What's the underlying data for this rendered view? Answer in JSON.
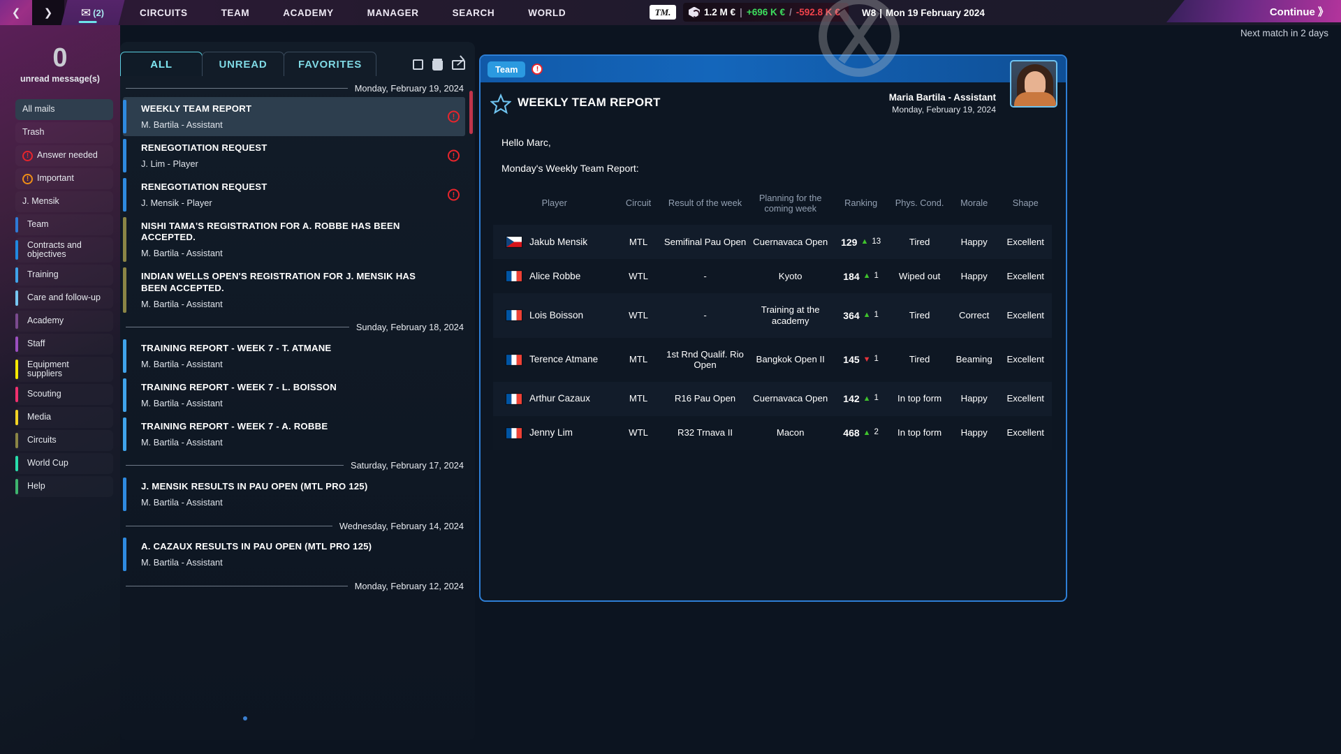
{
  "topbar": {
    "back_arrow": "❮",
    "forward_arrow": "❯",
    "mail_icon": "✉",
    "mail_count": "(2)",
    "nav": [
      "CIRCUITS",
      "TEAM",
      "ACADEMY",
      "MANAGER",
      "SEARCH",
      "WORLD"
    ],
    "tm_logo": "TM.",
    "money_total": "1.2 M €",
    "money_sep": "|",
    "money_income": "+696 K €",
    "money_slash": "/",
    "money_expense": "-592.8 K €",
    "week": "W8",
    "date_sep": "|",
    "date": "Mon 19 February 2024",
    "continue_label": "Continue 》",
    "next_match": "Next match in 2 days",
    "help_glyph": "?",
    "accent_income": "#3ddd5e",
    "accent_expense": "#f1434b"
  },
  "sidebar": {
    "unread_count": "0",
    "unread_label": "unread message(s)",
    "items": [
      {
        "label": "All mails",
        "active": true,
        "bar": null,
        "icon": null
      },
      {
        "label": "Trash",
        "active": false,
        "bar": null,
        "icon": null
      },
      {
        "label": "Answer needed",
        "active": false,
        "bar": null,
        "icon": "exclamation-red"
      },
      {
        "label": "Important",
        "active": false,
        "bar": null,
        "icon": "exclamation-orange"
      },
      {
        "label": "J. Mensik",
        "active": false,
        "bar": null,
        "icon": null
      },
      {
        "label": "Team",
        "active": false,
        "bar": "#2e7ad6",
        "icon": null
      },
      {
        "label": "Contracts and objectives",
        "active": false,
        "bar": "#2189e0",
        "icon": null,
        "two_line": true
      },
      {
        "label": "Training",
        "active": false,
        "bar": "#3fa3ea",
        "icon": null
      },
      {
        "label": "Care and follow-up",
        "active": false,
        "bar": "#77c7f2",
        "icon": null
      },
      {
        "label": "Academy",
        "active": false,
        "bar": "#7a4a8e",
        "icon": null
      },
      {
        "label": "Staff",
        "active": false,
        "bar": "#9b4fc0",
        "icon": null
      },
      {
        "label": "Equipment suppliers",
        "active": false,
        "bar": "#f5e800",
        "icon": null,
        "two_line": true
      },
      {
        "label": "Scouting",
        "active": false,
        "bar": "#f0306e",
        "icon": null
      },
      {
        "label": "Media",
        "active": false,
        "bar": "#f2d324",
        "icon": null
      },
      {
        "label": "Circuits",
        "active": false,
        "bar": "#8a8545",
        "icon": null
      },
      {
        "label": "World Cup",
        "active": false,
        "bar": "#28ddac",
        "icon": null
      },
      {
        "label": "Help",
        "active": false,
        "bar": "#3eb46e",
        "icon": null
      }
    ]
  },
  "maillist": {
    "tabs": [
      {
        "label": "ALL",
        "active": true
      },
      {
        "label": "UNREAD",
        "active": false
      },
      {
        "label": "FAVORITES",
        "active": false
      }
    ],
    "icons": [
      "select-box-icon",
      "trash-icon",
      "envelope-icon"
    ],
    "groups": [
      {
        "date": "Monday, February 19, 2024",
        "mails": [
          {
            "subject": "WEEKLY TEAM REPORT",
            "from": "M. Bartila - Assistant",
            "accent": "#2e8ae0",
            "selected": true,
            "flag": "!"
          },
          {
            "subject": "RENEGOTIATION REQUEST",
            "from": "J. Lim - Player",
            "accent": "#2e8ae0",
            "selected": false,
            "flag": "!"
          },
          {
            "subject": "RENEGOTIATION REQUEST",
            "from": "J. Mensik - Player",
            "accent": "#2e8ae0",
            "selected": false,
            "flag": "!"
          },
          {
            "subject": "NISHI TAMA'S REGISTRATION FOR A. ROBBE HAS BEEN ACCEPTED.",
            "from": "M. Bartila - Assistant",
            "accent": "#8a8545",
            "selected": false,
            "flag": null
          },
          {
            "subject": "INDIAN WELLS OPEN'S REGISTRATION FOR J. MENSIK HAS BEEN ACCEPTED.",
            "from": "M. Bartila - Assistant",
            "accent": "#8a8545",
            "selected": false,
            "flag": null
          }
        ]
      },
      {
        "date": "Sunday, February 18, 2024",
        "mails": [
          {
            "subject": "TRAINING REPORT - WEEK 7 - T. ATMANE",
            "from": "M. Bartila - Assistant",
            "accent": "#3fa3ea",
            "selected": false,
            "flag": null
          },
          {
            "subject": "TRAINING REPORT - WEEK 7 - L. BOISSON",
            "from": "M. Bartila - Assistant",
            "accent": "#3fa3ea",
            "selected": false,
            "flag": null
          },
          {
            "subject": "TRAINING REPORT - WEEK 7 - A. ROBBE",
            "from": "M. Bartila - Assistant",
            "accent": "#3fa3ea",
            "selected": false,
            "flag": null
          }
        ]
      },
      {
        "date": "Saturday, February 17, 2024",
        "mails": [
          {
            "subject": "J. MENSIK RESULTS IN PAU OPEN (MTL PRO 125)",
            "from": "M. Bartila - Assistant",
            "accent": "#2e8ae0",
            "selected": false,
            "flag": null
          }
        ]
      },
      {
        "date": "Wednesday, February 14, 2024",
        "mails": [
          {
            "subject": "A. CAZAUX RESULTS IN PAU OPEN (MTL PRO 125)",
            "from": "M. Bartila - Assistant",
            "accent": "#2e8ae0",
            "selected": false,
            "flag": null
          }
        ]
      },
      {
        "date": "Monday, February 12, 2024",
        "mails": []
      }
    ]
  },
  "reader": {
    "chip": "Team",
    "chip_flag": "!",
    "title": "WEEKLY TEAM REPORT",
    "sender_name": "Maria Bartila - Assistant",
    "sender_date": "Monday, February 19, 2024",
    "greeting": "Hello Marc,",
    "lead": "Monday's Weekly Team Report:",
    "columns": [
      "Player",
      "Circuit",
      "Result of the week",
      "Planning for the coming week",
      "Ranking",
      "Phys. Cond.",
      "Morale",
      "Shape"
    ],
    "rows": [
      {
        "player": "Jakub Mensik",
        "flag": "cz",
        "circuit": "MTL",
        "result": "Semifinal Pau Open",
        "planning": "Cuernavaca Open",
        "ranking": "129",
        "rank_dir": "up",
        "rank_delta": "13",
        "cond": "Tired",
        "cond_color": "#f2e13c",
        "morale": "Happy",
        "morale_color": "#3fc32d",
        "shape": "Excellent",
        "shape_color": "#3fc32d"
      },
      {
        "player": "Alice Robbe",
        "flag": "fr",
        "circuit": "WTL",
        "result": "-",
        "planning": "Kyoto",
        "ranking": "184",
        "rank_dir": "up",
        "rank_delta": "1",
        "cond": "Wiped out",
        "cond_color": "#f0862a",
        "morale": "Happy",
        "morale_color": "#3fc32d",
        "shape": "Excellent",
        "shape_color": "#3fc32d"
      },
      {
        "player": "Lois Boisson",
        "flag": "fr",
        "circuit": "WTL",
        "result": "-",
        "planning": "Training at the academy",
        "ranking": "364",
        "rank_dir": "up",
        "rank_delta": "1",
        "cond": "Tired",
        "cond_color": "#f2e13c",
        "morale": "Correct",
        "morale_color": "#f2e13c",
        "shape": "Excellent",
        "shape_color": "#3fc32d"
      },
      {
        "player": "Terence Atmane",
        "flag": "fr",
        "circuit": "MTL",
        "result": "1st Rnd Qualif. Rio Open",
        "planning": "Bangkok Open II",
        "ranking": "145",
        "rank_dir": "down",
        "rank_delta": "1",
        "cond": "Tired",
        "cond_color": "#f2e13c",
        "morale": "Beaming",
        "morale_color": "#7fe05a",
        "shape": "Excellent",
        "shape_color": "#3fc32d"
      },
      {
        "player": "Arthur Cazaux",
        "flag": "fr",
        "circuit": "MTL",
        "result": "R16 Pau Open",
        "planning": "Cuernavaca Open",
        "ranking": "142",
        "rank_dir": "up",
        "rank_delta": "1",
        "cond": "In top form",
        "cond_color": "#36d4a0",
        "morale": "Happy",
        "morale_color": "#3fc32d",
        "shape": "Excellent",
        "shape_color": "#3fc32d"
      },
      {
        "player": "Jenny Lim",
        "flag": "fr",
        "circuit": "WTL",
        "result": "R32 Trnava II",
        "planning": "Macon",
        "ranking": "468",
        "rank_dir": "up",
        "rank_delta": "2",
        "cond": "In top form",
        "cond_color": "#36d4a0",
        "morale": "Happy",
        "morale_color": "#3fc32d",
        "shape": "Excellent",
        "shape_color": "#3fc32d"
      }
    ]
  }
}
